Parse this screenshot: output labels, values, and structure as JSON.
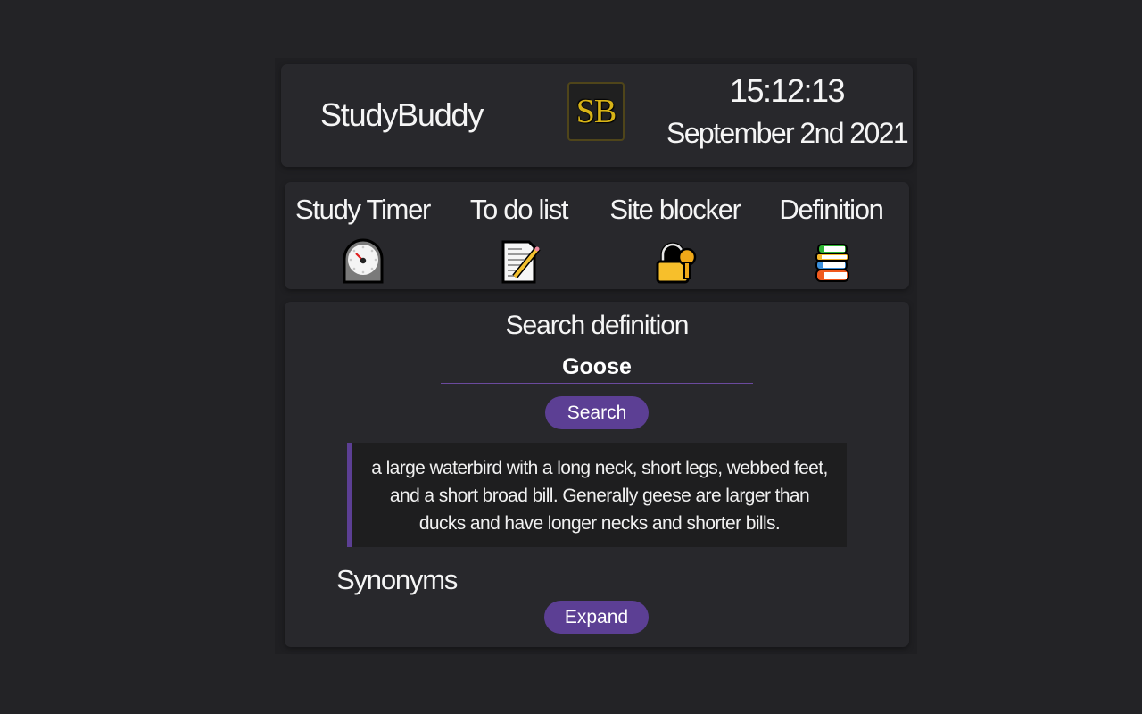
{
  "header": {
    "app_title": "StudyBuddy",
    "logo_text": "SB",
    "time": "15:12:13",
    "date": "September 2nd 2021"
  },
  "nav": {
    "items": [
      {
        "label": "Study Timer",
        "icon": "mantelpiece-clock-icon"
      },
      {
        "label": "To do list",
        "icon": "memo-pencil-icon"
      },
      {
        "label": "Site blocker",
        "icon": "lock-with-key-icon"
      },
      {
        "label": "Definition",
        "icon": "books-icon"
      }
    ]
  },
  "definition": {
    "title": "Search definition",
    "search_value": "Goose",
    "search_button": "Search",
    "result": "a large waterbird with a long neck, short legs, webbed feet, and a short broad bill. Generally geese are larger than ducks and have longer necks and shorter bills.",
    "synonyms_title": "Synonyms",
    "expand_button": "Expand"
  },
  "colors": {
    "accent": "#5c3f94",
    "logo_gold": "#d8b417",
    "panel_bg": "#28282c",
    "page_bg": "#232326"
  }
}
